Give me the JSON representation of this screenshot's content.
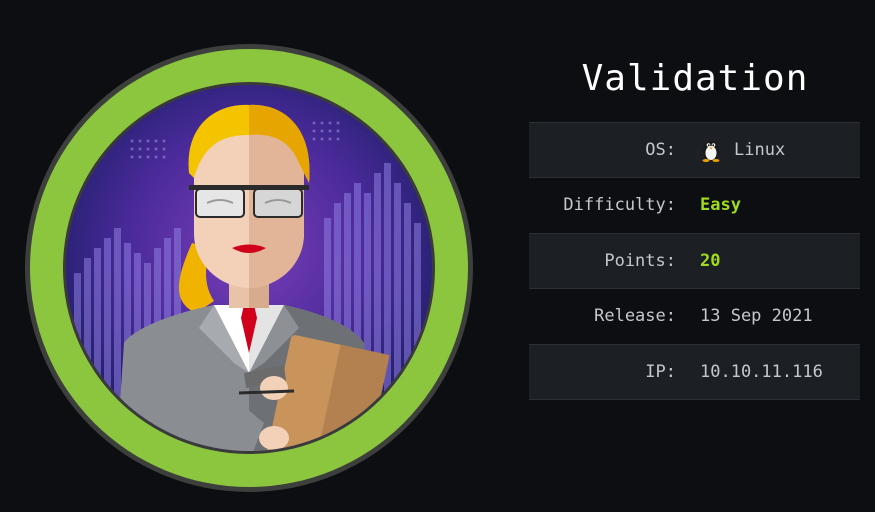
{
  "machine": {
    "name": "Validation"
  },
  "info": {
    "os_label": "OS:",
    "os_value": "Linux",
    "os_icon": "tux-penguin-icon",
    "difficulty_label": "Difficulty:",
    "difficulty_value": "Easy",
    "points_label": "Points:",
    "points_value": "20",
    "release_label": "Release:",
    "release_value": "13 Sep 2021",
    "ip_label": "IP:",
    "ip_value": "10.10.11.116"
  },
  "colors": {
    "background": "#0d0e11",
    "ring": "#8cc63f",
    "accent_green": "#9fdc1b",
    "row_shade": "#1c1f24"
  }
}
